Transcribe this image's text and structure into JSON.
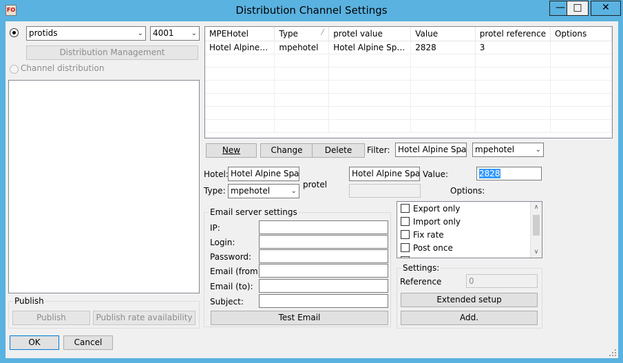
{
  "window": {
    "title": "Distribution Channel Settings",
    "icon": "app-icon",
    "icon_text": "FO"
  },
  "left": {
    "system_combo": "protids",
    "code_combo": "4001",
    "distribution_mgmt_label": "Distribution Management",
    "channel_dist_label": "Channel distribution",
    "publish_group_title": "Publish",
    "publish_label": "Publish",
    "publish_rate_label": "Publish rate availability"
  },
  "grid": {
    "columns": [
      "MPEHotel",
      "Type",
      "protel value",
      "Value",
      "protel reference",
      "Options"
    ],
    "rows": [
      [
        "Hotel Alpine Spa",
        "mpehotel",
        "Hotel Alpine Spa - A...",
        "2828",
        "3",
        ""
      ]
    ]
  },
  "actions": {
    "new_label": "New",
    "change_label": "Change",
    "delete_label": "Delete",
    "filter_label": "Filter:",
    "filter_hotel": "Hotel Alpine Spa",
    "filter_type": "mpehotel"
  },
  "edit": {
    "hotel_label": "Hotel:",
    "hotel_value": "Hotel Alpine Spa",
    "type_label": "Type:",
    "type_value": "mpehotel",
    "protel_label": "protel",
    "protel_combo": "Hotel Alpine Spa",
    "protel_text": "",
    "value_label": "Value:",
    "value_value": "2828",
    "options_label": "Options:"
  },
  "email": {
    "group_title": "Email server settings",
    "ip_label": "IP:",
    "login_label": "Login:",
    "password_label": "Password:",
    "email_from_label": "Email (from):",
    "email_to_label": "Email (to):",
    "subject_label": "Subject:",
    "test_email_label": "Test Email"
  },
  "options": {
    "items": [
      "Export only",
      "Import only",
      "Fix rate",
      "Post once"
    ]
  },
  "settings": {
    "group_title": "Settings:",
    "reference_label": "Reference",
    "reference_value": "0",
    "extended_setup_label": "Extended setup",
    "add_label": "Add."
  },
  "footer": {
    "ok_label": "OK",
    "cancel_label": "Cancel"
  }
}
